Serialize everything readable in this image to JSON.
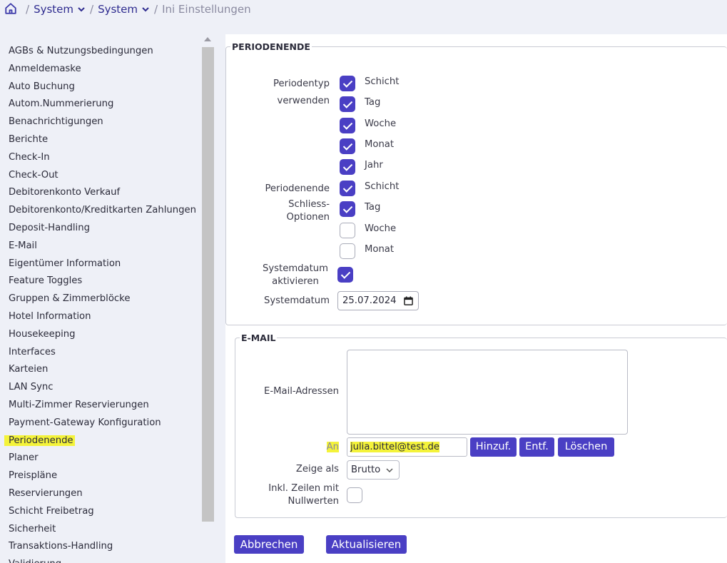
{
  "breadcrumb": {
    "home_icon": "home-icon",
    "items": [
      "System",
      "System"
    ],
    "current": "Ini Einstellungen"
  },
  "sidebar": {
    "items": [
      "AGBs & Nutzungsbedingungen",
      "Anmeldemaske",
      "Auto Buchung",
      "Autom.Nummerierung",
      "Benachrichtigungen",
      "Berichte",
      "Check-In",
      "Check-Out",
      "Debitorenkonto Verkauf",
      "Debitorenkonto/Kreditkarten Zahlungen",
      "Deposit-Handling",
      "E-Mail",
      "Eigentümer Information",
      "Feature Toggles",
      "Gruppen & Zimmerblöcke",
      "Hotel Information",
      "Housekeeping",
      "Interfaces",
      "Karteien",
      "LAN Sync",
      "Multi-Zimmer Reservierungen",
      "Payment-Gateway Konfiguration",
      "Periodenende",
      "Planer",
      "Preispläne",
      "Reservierungen",
      "Schicht Freibetrag",
      "Sicherheit",
      "Transaktions-Handling",
      "Validierung"
    ],
    "selected": "Periodenende"
  },
  "periodenende": {
    "legend": "PERIODENENDE",
    "periodentyp_label_1": "Periodentyp",
    "periodentyp_label_2": "verwenden",
    "periodentyp_options": [
      {
        "label": "Schicht",
        "checked": true
      },
      {
        "label": "Tag",
        "checked": true
      },
      {
        "label": "Woche",
        "checked": true
      },
      {
        "label": "Monat",
        "checked": true
      },
      {
        "label": "Jahr",
        "checked": true
      }
    ],
    "schliess_label_1": "Periodenende",
    "schliess_label_2": "Schliess-Optionen",
    "schliess_options": [
      {
        "label": "Schicht",
        "checked": true
      },
      {
        "label": "Tag",
        "checked": true
      },
      {
        "label": "Woche",
        "checked": false
      },
      {
        "label": "Monat",
        "checked": false
      }
    ],
    "systemdatum_aktivieren_1": "Systemdatum",
    "systemdatum_aktivieren_2": "aktivieren",
    "systemdatum_aktivieren_checked": true,
    "systemdatum_label": "Systemdatum",
    "systemdatum_value": "25.07.2024"
  },
  "email": {
    "legend": "E-MAIL",
    "adressen_label": "E-Mail-Adressen",
    "an_label": "An",
    "an_value": "julia.bittel@test.de",
    "btn_add": "Hinzuf.",
    "btn_remove": "Entf.",
    "btn_delete": "Löschen",
    "zeige_als_label": "Zeige als",
    "zeige_als_value": "Brutto",
    "nullwerte_label_1": "Inkl. Zeilen mit",
    "nullwerte_label_2": "Nullwerten",
    "nullwerte_checked": false
  },
  "footer": {
    "cancel": "Abbrechen",
    "update": "Aktualisieren"
  },
  "colors": {
    "accent": "#4a3fc4",
    "highlight": "#f4f33a",
    "background": "#eef0f7"
  }
}
